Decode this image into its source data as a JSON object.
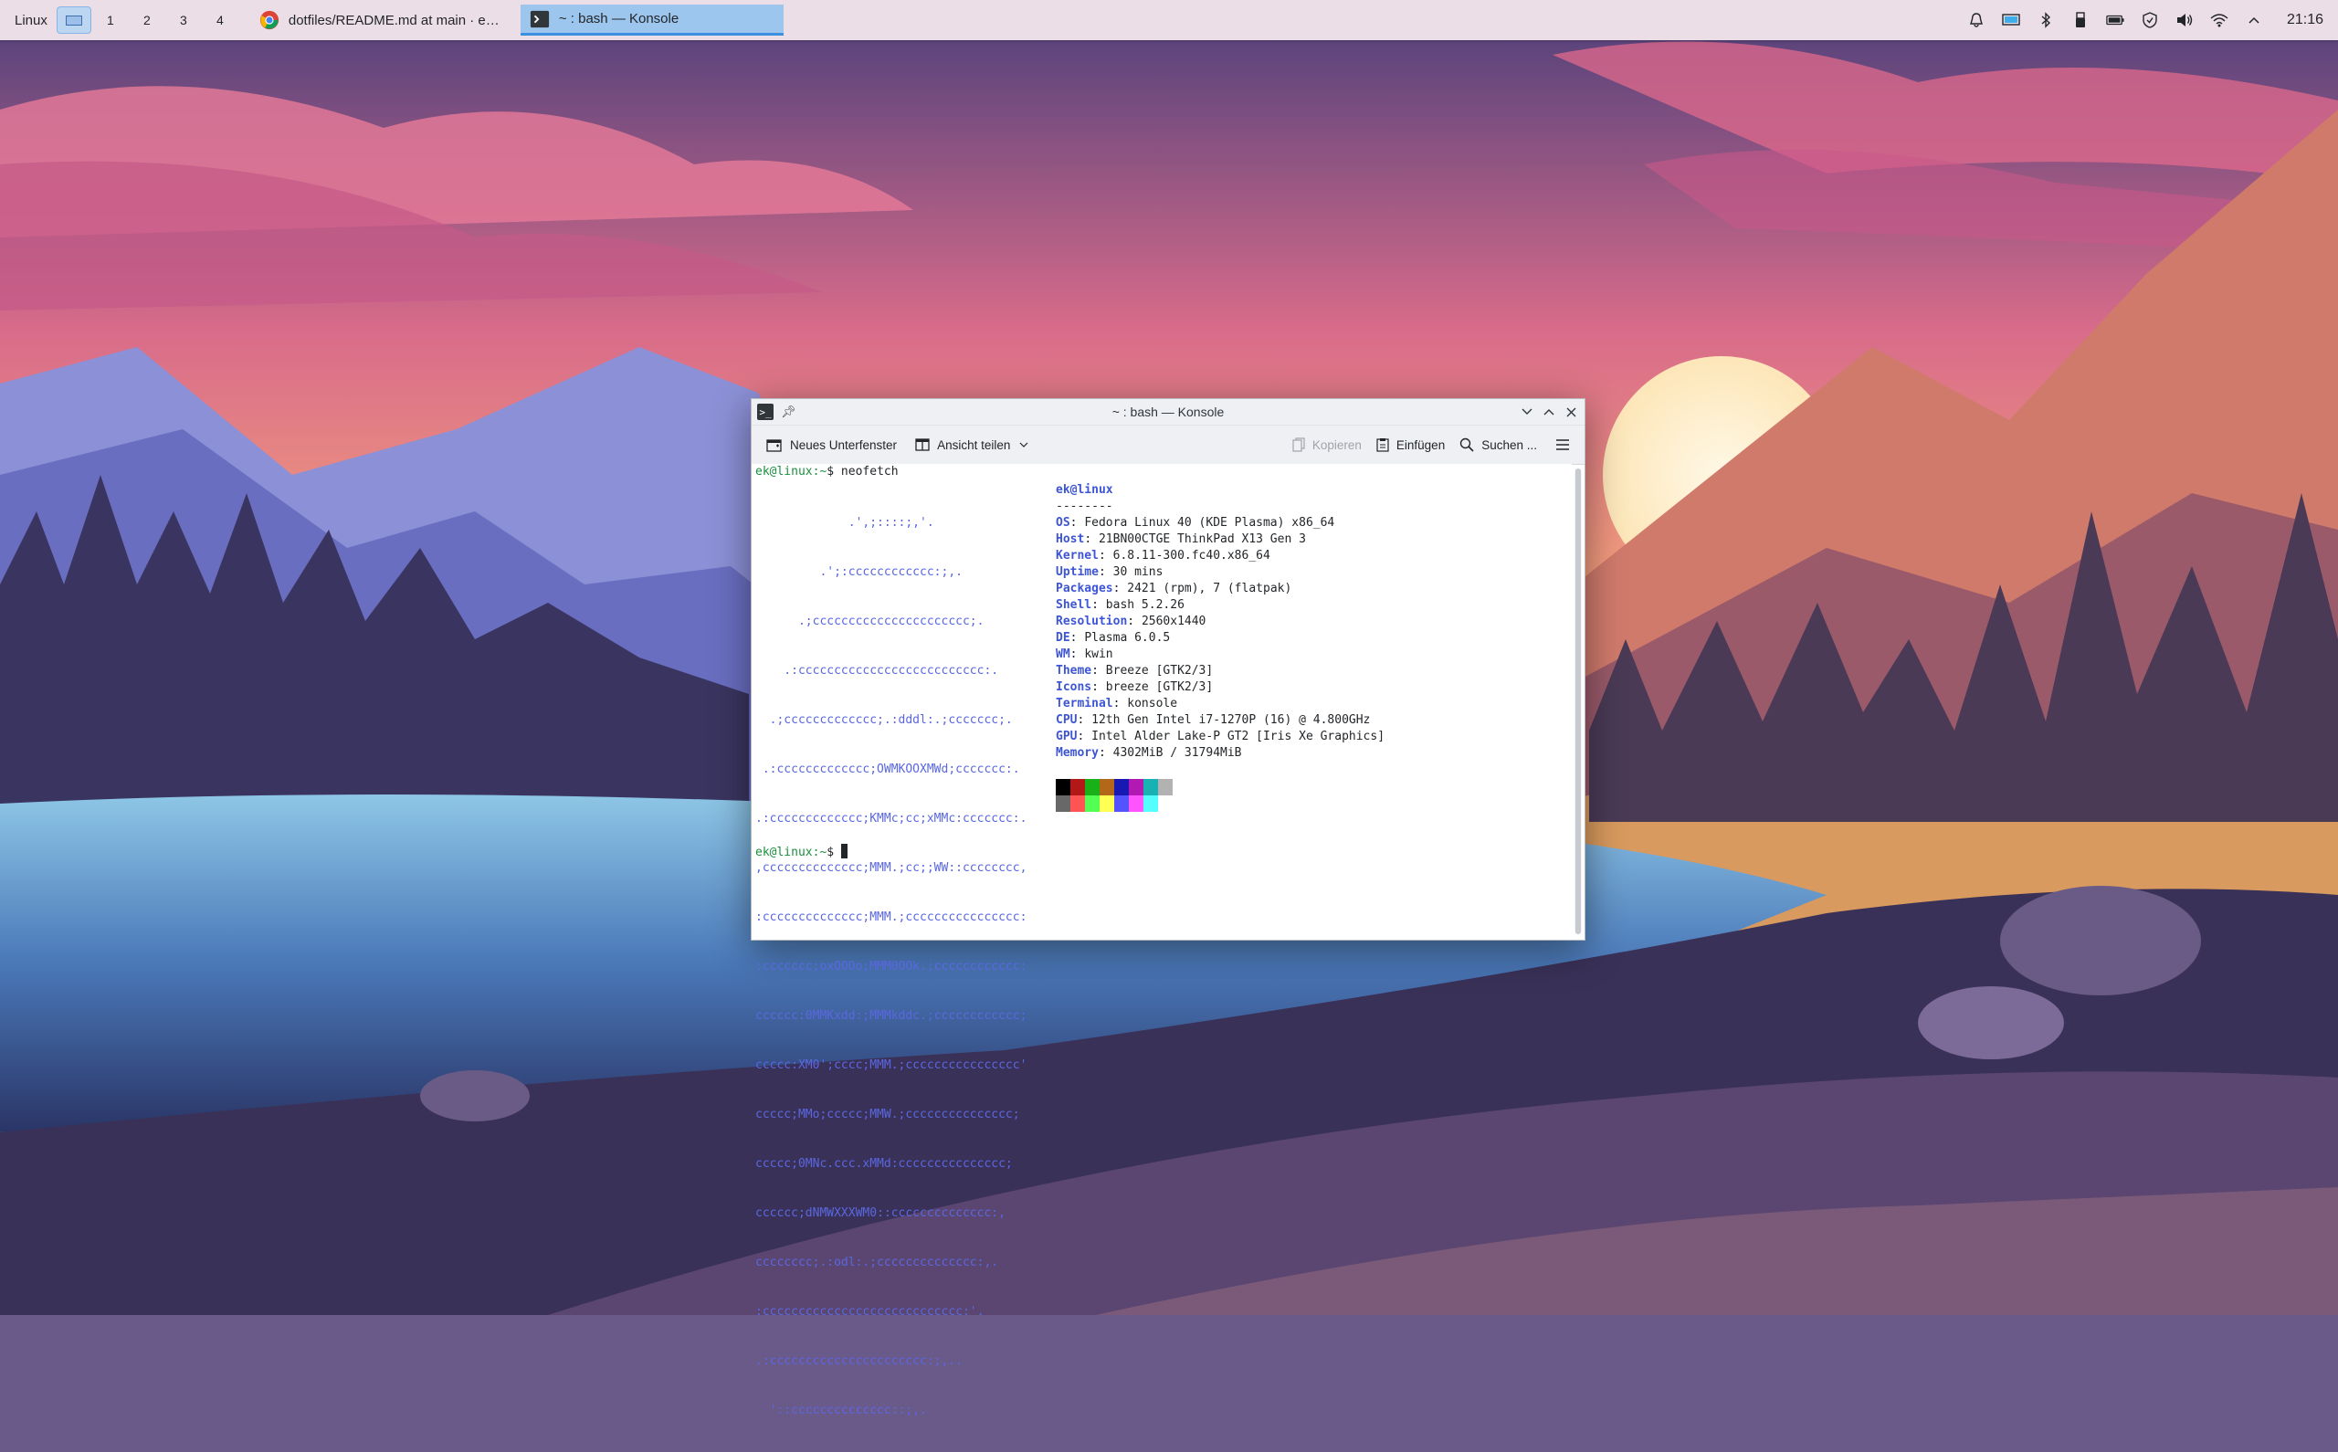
{
  "panel": {
    "activity_label": "Linux",
    "virtual_desktops": [
      "1",
      "2",
      "3",
      "4"
    ],
    "tasks": [
      {
        "label": "dotfiles/README.md at main · ek92...",
        "icon": "chrome-icon"
      },
      {
        "label": "~ : bash — Konsole",
        "icon": "konsole-icon"
      }
    ],
    "clock": "21:16"
  },
  "konsole": {
    "title": "~ : bash — Konsole",
    "toolbar": {
      "new_tab": "Neues Unterfenster",
      "split_view": "Ansicht teilen",
      "copy": "Kopieren",
      "paste": "Einfügen",
      "search": "Suchen ..."
    },
    "prompt": "ek@linux:~$",
    "prompt_user": "ek@linux:~",
    "prompt_symbol": "$",
    "command": " neofetch",
    "info_header": "ek@linux",
    "separator": "--------",
    "info": [
      {
        "label": "OS",
        "value": "Fedora Linux 40 (KDE Plasma) x86_64"
      },
      {
        "label": "Host",
        "value": "21BN00CTGE ThinkPad X13 Gen 3"
      },
      {
        "label": "Kernel",
        "value": "6.8.11-300.fc40.x86_64"
      },
      {
        "label": "Uptime",
        "value": "30 mins"
      },
      {
        "label": "Packages",
        "value": "2421 (rpm), 7 (flatpak)"
      },
      {
        "label": "Shell",
        "value": "bash 5.2.26"
      },
      {
        "label": "Resolution",
        "value": "2560x1440"
      },
      {
        "label": "DE",
        "value": "Plasma 6.0.5"
      },
      {
        "label": "WM",
        "value": "kwin"
      },
      {
        "label": "Theme",
        "value": "Breeze [GTK2/3]"
      },
      {
        "label": "Icons",
        "value": "breeze [GTK2/3]"
      },
      {
        "label": "Terminal",
        "value": "konsole"
      },
      {
        "label": "CPU",
        "value": "12th Gen Intel i7-1270P (16) @ 4.800GHz"
      },
      {
        "label": "GPU",
        "value": "Intel Alder Lake-P GT2 [Iris Xe Graphics]"
      },
      {
        "label": "Memory",
        "value": "4302MiB / 31794MiB"
      }
    ],
    "palette_row1": [
      "#000000",
      "#b21818",
      "#18b218",
      "#b26818",
      "#1818b2",
      "#b218b2",
      "#18b2b2",
      "#b2b2b2"
    ],
    "palette_row2": [
      "#686868",
      "#ff5454",
      "#54ff54",
      "#ffff54",
      "#5454ff",
      "#ff54ff",
      "#54ffff",
      "#ffffff"
    ],
    "logo_lines": [
      "             .',;::::;,'.",
      "         .';:cccccccccccc:;,.",
      "      .;cccccccccccccccccccccc;.",
      "    .:cccccccccccccccccccccccccc:.",
      "  .;ccccccccccccc;.:dddl:.;ccccccc;.",
      " .:ccccccccccccc;OWMKOOXMWd;ccccccc:.",
      ".:ccccccccccccc;KMMc;cc;xMMc:ccccccc:.",
      ",cccccccccccccc;MMM.;cc;;WW::cccccccc,",
      ":cccccccccccccc;MMM.;cccccccccccccccc:",
      ":ccccccc;oxOOOo;MMM0OOk.;cccccccccccc:",
      "cccccc:0MMKxdd:;MMMkddc.;cccccccccccc;",
      "ccccc:XM0';cccc;MMM.;cccccccccccccccc'",
      "ccccc;MMo;ccccc;MMW.;ccccccccccccccc;",
      "ccccc;0MNc.ccc.xMMd:ccccccccccccccc;",
      "cccccc;dNMWXXXWM0::cccccccccccccc:,",
      "cccccccc;.:odl:.;cccccccccccccc:,.",
      ":cccccccccccccccccccccccccccc:'.",
      ".:cccccccccccccccccccccc:;,..",
      "  '::cccccccccccccc::;,."
    ]
  }
}
